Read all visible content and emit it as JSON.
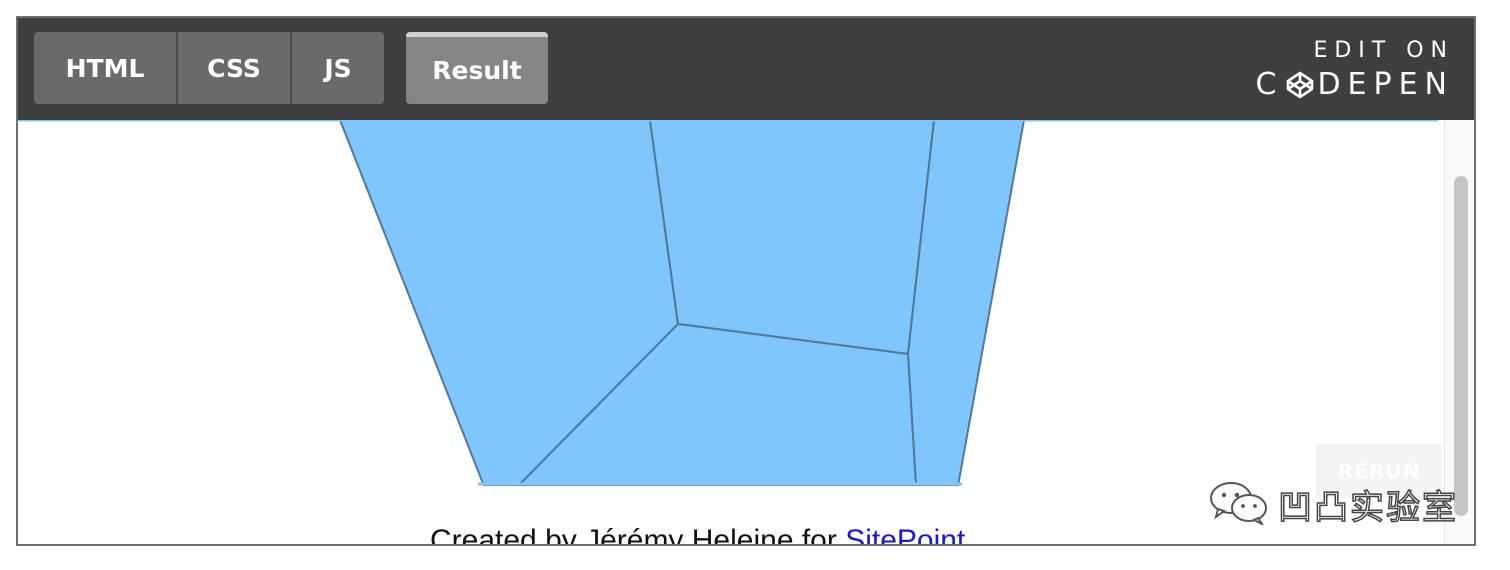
{
  "tabs": [
    {
      "label": "HTML"
    },
    {
      "label": "CSS"
    },
    {
      "label": "JS"
    },
    {
      "label": "Result",
      "active": true
    }
  ],
  "brand": {
    "line1": "EDIT ON",
    "line2_prefix": "C",
    "line2_suffix": "DEPEN"
  },
  "result": {
    "credit_prefix": "Created by Jérémy Heleine for ",
    "credit_link": "SitePoint",
    "rerun_label": "RERUN"
  },
  "watermark": {
    "text": "凹凸实验室"
  },
  "colors": {
    "toolbar_bg": "#3f3f3f",
    "tab_bg": "#6a6a6a",
    "tab_active_bg": "#858585",
    "cube_face": "#7fc6fc",
    "cube_edge": "#52789a",
    "link": "#1a1acc"
  },
  "icons": [
    "codepen-logo-icon",
    "wechat-icon"
  ]
}
